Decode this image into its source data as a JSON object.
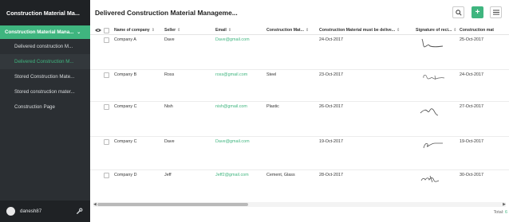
{
  "sidebar": {
    "app_title": "Construction Material Ma...",
    "group_label": "Construction Material Mana...",
    "items": [
      {
        "label": "Delivered construction M..."
      },
      {
        "label": "Delivered Construction M..."
      },
      {
        "label": "Stored Construction Mate..."
      },
      {
        "label": "Stored construction mater..."
      },
      {
        "label": "Construction Page"
      }
    ],
    "user": {
      "name": "danesh87"
    }
  },
  "header": {
    "title": "Delivered Construction Material Manageme..."
  },
  "table": {
    "columns": [
      {
        "label": "Name of company"
      },
      {
        "label": "Seller"
      },
      {
        "label": "Email"
      },
      {
        "label": "Construction Mat..."
      },
      {
        "label": "Construction Material must be delive..."
      },
      {
        "label": "Signature of reci..."
      },
      {
        "label": "Construction mat"
      }
    ],
    "sort_glyph": "⇕",
    "rows": [
      {
        "company": "Company A",
        "seller": "Dave",
        "email": "Dave@gmail.com",
        "material": "",
        "must_deliver": "24-Oct-2017",
        "construction_date": "25-Oct-2017"
      },
      {
        "company": "Company B",
        "seller": "Ross",
        "email": "ross@gmail.com",
        "material": "Steel",
        "must_deliver": "23-Oct-2017",
        "construction_date": "24-Oct-2017"
      },
      {
        "company": "Company C",
        "seller": "Nish",
        "email": "nish@gmail.com",
        "material": "Plastic",
        "must_deliver": "26-Oct-2017",
        "construction_date": "27-Oct-2017"
      },
      {
        "company": "Company C",
        "seller": "Dave",
        "email": "Dave@gmail.com",
        "material": "",
        "must_deliver": "19-Oct-2017",
        "construction_date": "19-Oct-2017"
      },
      {
        "company": "Company D",
        "seller": "Jeff",
        "email": "Jeff2@gmail.com",
        "material": "Cement, Glass",
        "must_deliver": "28-Oct-2017",
        "construction_date": "30-Oct-2017"
      }
    ]
  },
  "footer": {
    "total_label": "Total:",
    "total_count": "6"
  },
  "colors": {
    "accent": "#3fb57f",
    "sidebar_bg": "#2b2f33",
    "sidebar_dark": "#1f2225"
  },
  "icons": {
    "search": "search-icon",
    "add": "plus-icon",
    "menu": "hamburger-icon",
    "settings": "wrench-icon",
    "visibility": "eye-icon"
  }
}
